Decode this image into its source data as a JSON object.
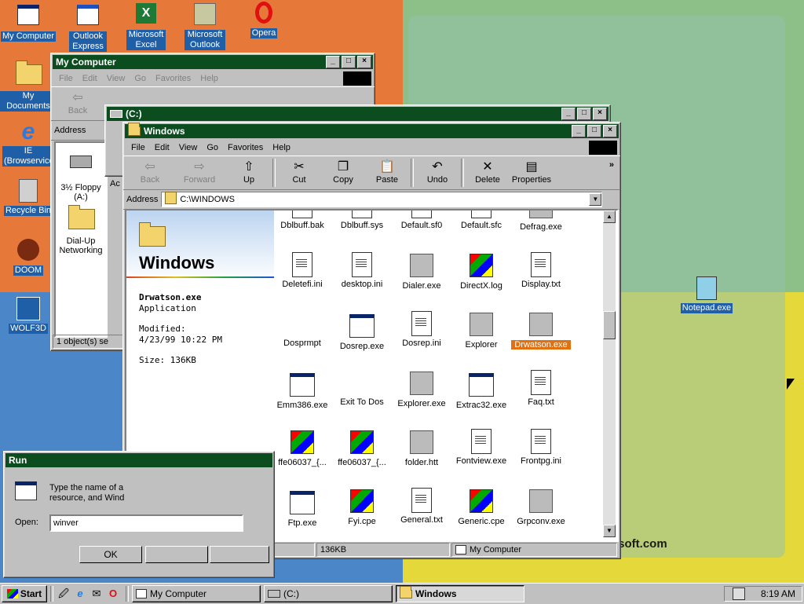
{
  "desktop": {
    "brand": "osoft.com",
    "icons": [
      {
        "label": "My Computer"
      },
      {
        "label": "Outlook Express"
      },
      {
        "label": "Microsoft Excel"
      },
      {
        "label": "Microsoft Outlook"
      },
      {
        "label": "Opera"
      },
      {
        "label": "My Documents"
      },
      {
        "label": "IE (Browservice)"
      },
      {
        "label": "Recycle Bin"
      },
      {
        "label": "DOOM"
      },
      {
        "label": "WOLF3D"
      },
      {
        "label": "Notepad.exe"
      }
    ]
  },
  "mycomputer": {
    "title": "My Computer",
    "menu": [
      "File",
      "Edit",
      "View",
      "Go",
      "Favorites",
      "Help"
    ],
    "back": "Back",
    "address_label": "Address",
    "items": [
      {
        "label": "3½ Floppy (A:)"
      },
      {
        "label": "Dial-Up Networking"
      }
    ],
    "status": "1 object(s) se"
  },
  "cdrive": {
    "title": "(C:)",
    "partial_addr": "Ac"
  },
  "windows": {
    "title": "Windows",
    "menu": [
      "File",
      "Edit",
      "View",
      "Go",
      "Favorites",
      "Help"
    ],
    "toolbar": [
      {
        "label": "Back",
        "icon": "back-arrow-icon",
        "glyph": "⇦"
      },
      {
        "label": "Forward",
        "icon": "forward-arrow-icon",
        "glyph": "⇨"
      },
      {
        "label": "Up",
        "icon": "up-folder-icon",
        "glyph": "⇧"
      },
      {
        "label": "Cut",
        "icon": "scissors-icon",
        "glyph": "✂"
      },
      {
        "label": "Copy",
        "icon": "copy-icon",
        "glyph": "❐"
      },
      {
        "label": "Paste",
        "icon": "paste-icon",
        "glyph": "📋"
      },
      {
        "label": "Undo",
        "icon": "undo-icon",
        "glyph": "↶"
      },
      {
        "label": "Delete",
        "icon": "delete-icon",
        "glyph": "✕"
      },
      {
        "label": "Properties",
        "icon": "properties-icon",
        "glyph": "▤"
      }
    ],
    "address_label": "Address",
    "address": "C:\\WINDOWS",
    "panel": {
      "heading": "Windows",
      "file_name": "Drwatson.exe",
      "file_type": "Application",
      "modified_label": "Modified:",
      "modified": "4/23/99 10:22 PM",
      "size": "Size: 136KB"
    },
    "files": [
      {
        "label": "Dblbuff.bak",
        "kind": "doc"
      },
      {
        "label": "Dblbuff.sys",
        "kind": "doc"
      },
      {
        "label": "Default.sf0",
        "kind": "doc"
      },
      {
        "label": "Default.sfc",
        "kind": "doc"
      },
      {
        "label": "Defrag.exe",
        "kind": "gear"
      },
      {
        "label": "Deletefi.ini",
        "kind": "doc"
      },
      {
        "label": "desktop.ini",
        "kind": "doc"
      },
      {
        "label": "Dialer.exe",
        "kind": "gear"
      },
      {
        "label": "DirectX.log",
        "kind": "xlogo"
      },
      {
        "label": "Display.txt",
        "kind": "doc"
      },
      {
        "label": "Dosprmpt",
        "kind": "msdos"
      },
      {
        "label": "Dosrep.exe",
        "kind": "winapp"
      },
      {
        "label": "Dosrep.ini",
        "kind": "doc"
      },
      {
        "label": "Explorer",
        "kind": "gear"
      },
      {
        "label": "Drwatson.exe",
        "kind": "gear",
        "selected": true
      },
      {
        "label": "Emm386.exe",
        "kind": "winapp"
      },
      {
        "label": "Exit To Dos",
        "kind": "msdos"
      },
      {
        "label": "Explorer.exe",
        "kind": "gear"
      },
      {
        "label": "Extrac32.exe",
        "kind": "winapp"
      },
      {
        "label": "Faq.txt",
        "kind": "doc"
      },
      {
        "label": "ffe06037_{...",
        "kind": "xlogo"
      },
      {
        "label": "ffe06037_{...",
        "kind": "xlogo"
      },
      {
        "label": "folder.htt",
        "kind": "gear"
      },
      {
        "label": "Fontview.exe",
        "kind": "doc"
      },
      {
        "label": "Frontpg.ini",
        "kind": "doc"
      },
      {
        "label": "Ftp.exe",
        "kind": "winapp"
      },
      {
        "label": "Fyi.cpe",
        "kind": "xlogo"
      },
      {
        "label": "General.txt",
        "kind": "doc"
      },
      {
        "label": "Generic.cpe",
        "kind": "xlogo"
      },
      {
        "label": "Grpconv.exe",
        "kind": "gear"
      }
    ],
    "status_size": "136KB",
    "status_zone": "My Computer"
  },
  "run": {
    "title": "Run",
    "prompt_line1": "Type the name of a",
    "prompt_line2": "resource, and Wind",
    "open_label": "Open:",
    "open_value": "winver",
    "ok": "OK"
  },
  "taskbar": {
    "start": "Start",
    "buttons": [
      {
        "label": "My Computer"
      },
      {
        "label": "(C:)"
      },
      {
        "label": "Windows"
      }
    ],
    "clock": "8:19 AM"
  },
  "colors": {
    "title_active": "#0b4d1f",
    "selection": "#e07010",
    "taskbar": "#c0c0c0"
  }
}
